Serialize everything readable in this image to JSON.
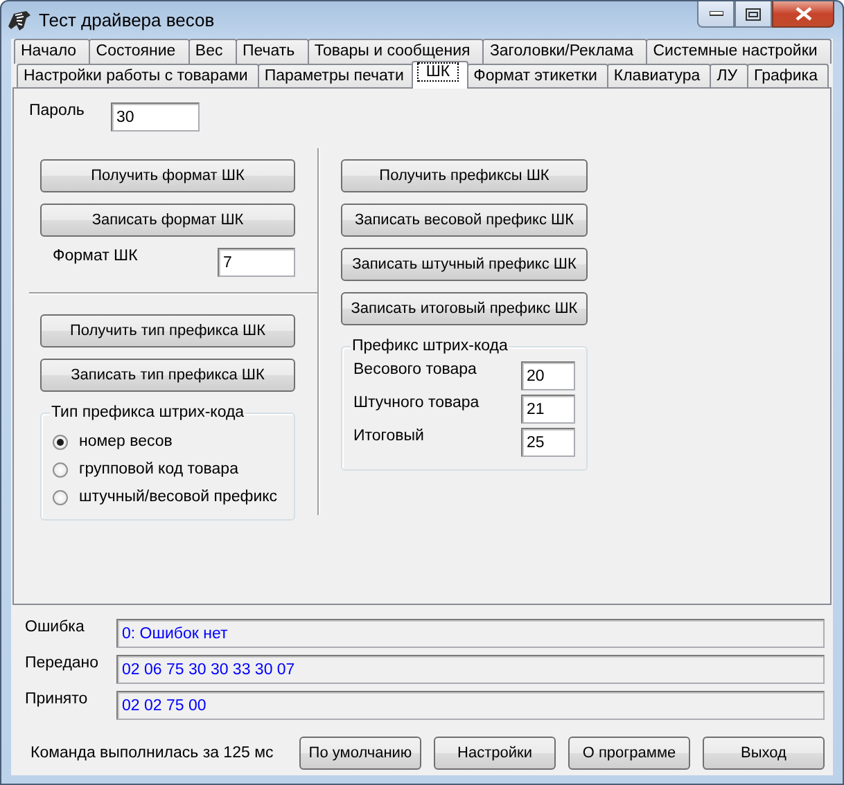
{
  "window": {
    "title": "Тест драйвера весов"
  },
  "tab_rows": [
    [
      {
        "label": "Начало",
        "selected": false
      },
      {
        "label": "Состояние",
        "selected": false
      },
      {
        "label": "Вес",
        "selected": false
      },
      {
        "label": "Печать",
        "selected": false
      },
      {
        "label": "Товары и сообщения",
        "selected": false
      },
      {
        "label": "Заголовки/Реклама",
        "selected": false
      },
      {
        "label": "Системные настройки",
        "selected": false
      }
    ],
    [
      {
        "label": "Настройки работы с товарами",
        "selected": false
      },
      {
        "label": "Параметры печати",
        "selected": false
      },
      {
        "label": "ШК",
        "selected": true
      },
      {
        "label": "Формат этикетки",
        "selected": false
      },
      {
        "label": "Клавиатура",
        "selected": false
      },
      {
        "label": "ЛУ",
        "selected": false
      },
      {
        "label": "Графика",
        "selected": false
      }
    ]
  ],
  "password": {
    "label": "Пароль",
    "value": "30"
  },
  "format_section": {
    "buttons": [
      "Получить формат ШК",
      "Записать формат ШК"
    ],
    "field": {
      "label": "Формат ШК",
      "value": "7"
    }
  },
  "prefix_type_section": {
    "buttons": [
      "Получить тип префикса ШК",
      "Записать тип префикса ШК"
    ],
    "group": {
      "title": "Тип префикса штрих-кода",
      "options": [
        {
          "label": "номер весов",
          "selected": true
        },
        {
          "label": "групповой код товара",
          "selected": false
        },
        {
          "label": "штучный/весовой префикс",
          "selected": false
        }
      ]
    }
  },
  "prefix_section": {
    "buttons": [
      "Получить префиксы ШК",
      "Записать весовой префикс ШК",
      "Записать штучный префикс ШК",
      "Записать итоговый префикс ШК"
    ],
    "group": {
      "title": "Префикс штрих-кода",
      "fields": [
        {
          "label": "Весового товара",
          "value": "20"
        },
        {
          "label": "Штучного товара",
          "value": "21"
        },
        {
          "label": "Итоговый",
          "value": "25"
        }
      ]
    }
  },
  "log": [
    {
      "label": "Ошибка",
      "value": "0: Ошибок нет"
    },
    {
      "label": "Передано",
      "value": "02 06 75 30 30 33 30 07"
    },
    {
      "label": "Принято",
      "value": "02 02 75 00"
    }
  ],
  "status": "Команда выполнилась за 125 мс",
  "buttons": [
    "По умолчанию",
    "Настройки",
    "О программе",
    "Выход"
  ]
}
